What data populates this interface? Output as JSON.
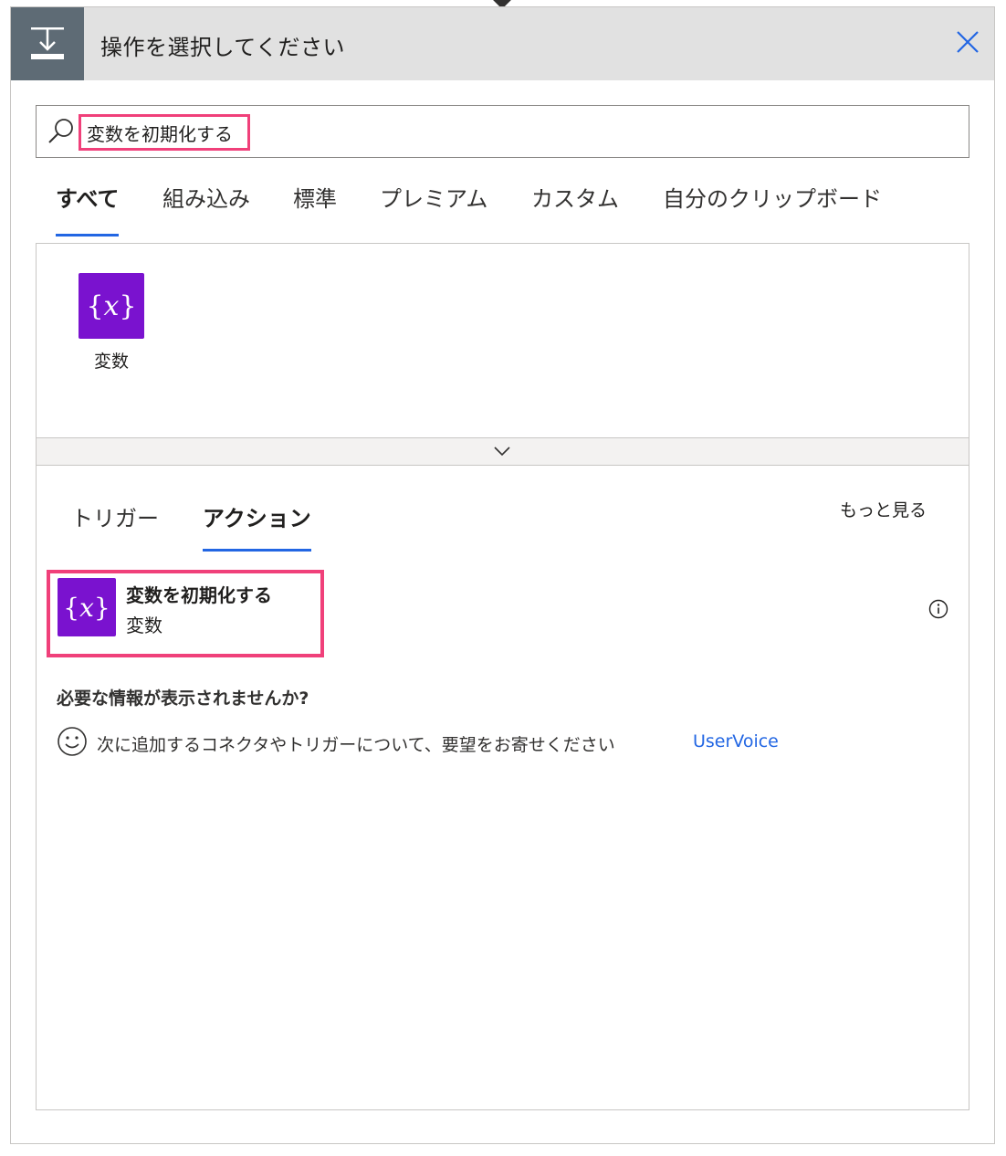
{
  "header": {
    "title": "操作を選択してください",
    "icon": "action-step-icon",
    "close_icon": "close-icon"
  },
  "search": {
    "value": "変数を初期化する",
    "icon": "search-icon"
  },
  "tabs": [
    {
      "label": "すべて",
      "active": true
    },
    {
      "label": "組み込み",
      "active": false
    },
    {
      "label": "標準",
      "active": false
    },
    {
      "label": "プレミアム",
      "active": false
    },
    {
      "label": "カスタム",
      "active": false
    },
    {
      "label": "自分のクリップボード",
      "active": false
    }
  ],
  "connectors": [
    {
      "label": "変数",
      "icon": "variable-icon",
      "icon_text": "{𝑥}"
    }
  ],
  "subtabs": [
    {
      "label": "トリガー",
      "active": false
    },
    {
      "label": "アクション",
      "active": true
    }
  ],
  "see_more": "もっと見る",
  "actions": [
    {
      "title": "変数を初期化する",
      "connector": "変数",
      "icon": "variable-icon",
      "icon_text": "{𝑥}"
    }
  ],
  "footer": {
    "need_info": "必要な情報が表示されませんか?",
    "request_text": "次に追加するコネクタやトリガーについて、要望をお寄せください",
    "link_label": "UserVoice"
  },
  "colors": {
    "accent": "#2266e3",
    "highlight": "#f0407a",
    "connector_purple": "#7a12cf",
    "header_bg": "#e1e1e1",
    "header_icon_bg": "#5e6b75"
  }
}
